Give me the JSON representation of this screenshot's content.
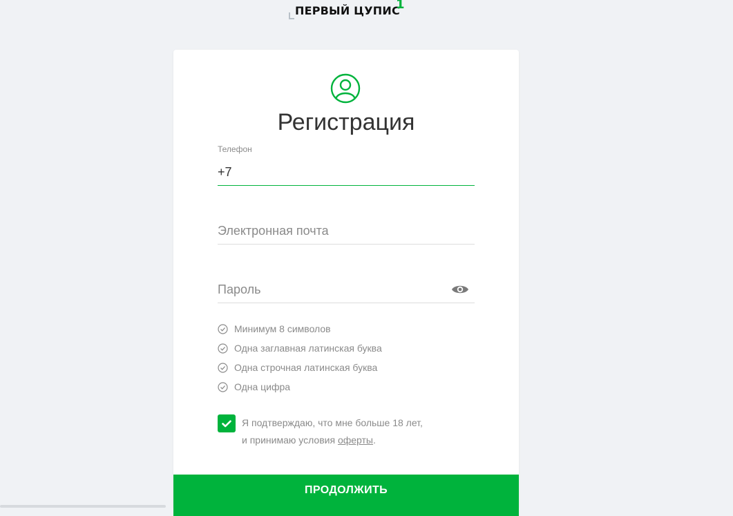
{
  "logo": {
    "text": "ПЕРВЫЙ ЦУПИС",
    "mark": "1"
  },
  "form": {
    "title": "Регистрация",
    "phone": {
      "label": "Телефон",
      "value": "+7"
    },
    "email": {
      "placeholder": "Электронная почта"
    },
    "password": {
      "placeholder": "Пароль"
    }
  },
  "rules": [
    "Минимум 8 символов",
    "Одна заглавная латинская буква",
    "Одна строчная латинская буква",
    "Одна цифра"
  ],
  "agreement": {
    "line1": "Я подтверждаю, что мне больше 18 лет,",
    "line2_prefix": "и принимаю условия ",
    "link": "оферты",
    "line2_suffix": "."
  },
  "submit_label": "ПРОДОЛЖИТЬ",
  "colors": {
    "accent": "#00b33c",
    "muted": "#8a8a8a",
    "background": "#f0f2f5"
  }
}
